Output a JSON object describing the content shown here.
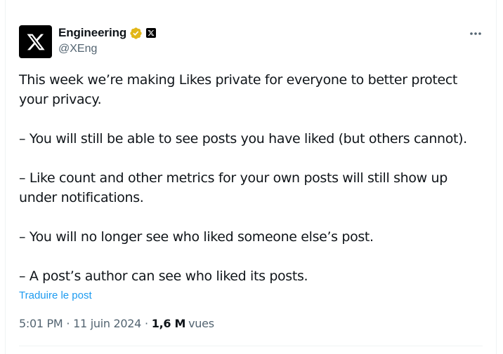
{
  "author": {
    "display_name": "Engineering",
    "handle": "@XEng",
    "avatar_icon": "x-logo-icon",
    "verified_icon": "gold-verified-badge-icon",
    "affiliate_icon": "x-affiliate-badge-icon"
  },
  "post": {
    "paragraphs": [
      "This week we’re making Likes private for everyone to better protect your privacy.",
      "– You will still be able to see posts you have liked (but others cannot).",
      "– Like count and other metrics for your own posts will still show up under notifications.",
      "– You will no longer see who liked someone else’s post.",
      "– A post’s author can see who liked its posts."
    ],
    "translate_label": "Traduire le post"
  },
  "meta": {
    "time": "5:01 PM",
    "separator": "·",
    "date": "11 juin 2024",
    "views_count": "1,6 M",
    "views_label": "vues"
  },
  "colors": {
    "text": "#0f1419",
    "secondary": "#536471",
    "link": "#1d9bf0",
    "verified_gold": "#e2b719"
  }
}
